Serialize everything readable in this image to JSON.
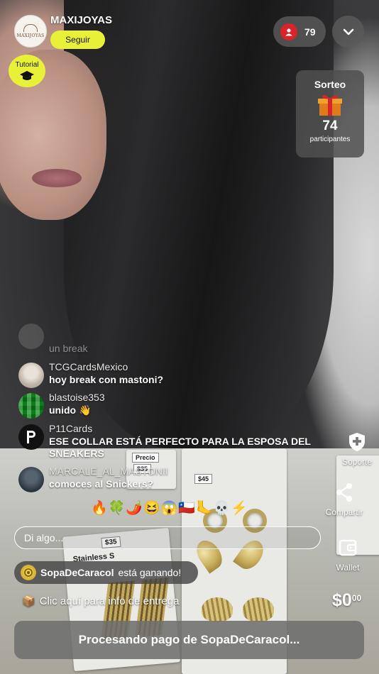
{
  "header": {
    "avatar_text": "MAXIJOYAS",
    "store_name": "MAXIJOYAS",
    "follow_label": "Seguir",
    "tutorial_label": "Tutorial",
    "viewer_count": "79"
  },
  "sorteo": {
    "title": "Sorteo",
    "count": "74",
    "subtitle": "participantes"
  },
  "chat": [
    {
      "user": "",
      "text": "un break"
    },
    {
      "user": "TCGCardsMexico",
      "text": "hoy break con mastoni?"
    },
    {
      "user": "blastoise353",
      "text": "unido 👋"
    },
    {
      "user": "P11Cards",
      "text_line1": "ESE COLLAR ESTÁ PERFECTO PARA LA ESPOSA DEL",
      "text_line2": "SNEAKERS"
    },
    {
      "user": "MARCALE_AL_MASTONII",
      "text": "comoces al Snickers?"
    }
  ],
  "emoji_bar": "🔥🍀🌶️😆😱🇨🇱🦶💀⚡",
  "input": {
    "placeholder": "Di algo..."
  },
  "winner": {
    "user": "SopaDeCaracol",
    "suffix": "está ganando!"
  },
  "delivery": {
    "icon": "📦",
    "text": "Clic aquí para info de entrega"
  },
  "price": {
    "main": "$0",
    "cents": "00"
  },
  "pay_button": "Procesando pago de SopaDeCaracol...",
  "side_actions": {
    "support": "Soporte",
    "share": "Compartir",
    "wallet": "Wallet"
  },
  "product_tags": [
    "Precio",
    "$35",
    "$45",
    "$35",
    "Stainless S"
  ],
  "colors": {
    "accent": "#e8f037",
    "live_red": "#d8232a"
  }
}
